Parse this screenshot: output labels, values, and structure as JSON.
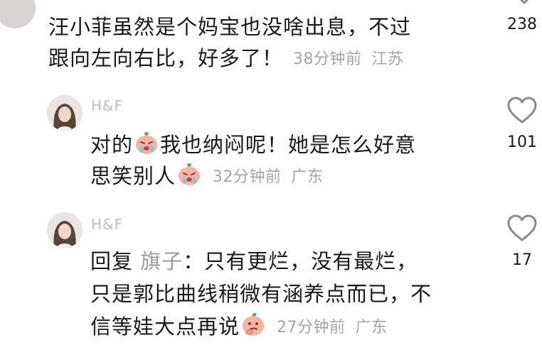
{
  "comment_1": {
    "line_1": "汪小菲虽然是个妈宝也没啥出息，不过",
    "line_2": "跟向左向右比，好多了！",
    "time": "38分钟前",
    "location": "江苏",
    "like_count": "238"
  },
  "reply_1": {
    "username": "H&F",
    "line_1_a": "对的",
    "line_1_b": "我也纳闷呢！她是怎么好意",
    "line_2": "思笑别人",
    "time": "32分钟前",
    "location": "广东",
    "like_count": "101"
  },
  "reply_2": {
    "username": "H&F",
    "reply_prefix": "回复",
    "reply_to": "旗子",
    "line_1_rest": "：只有更烂，没有最烂，",
    "line_2": "只是郭比曲线稍微有涵养点而已，不",
    "line_3": "信等娃大点再说",
    "time": "27分钟前",
    "location": "广东",
    "like_count": "17"
  },
  "icons": {
    "like": "heart-outline-icon",
    "emoji_cry": "crying-face-emoji",
    "emoji_think": "thinking-face-emoji"
  },
  "colors": {
    "text": "#161823",
    "meta": "#a2a3a8",
    "emoji_body": "#f6b5a4",
    "emoji_leaf": "#4fb35a"
  }
}
